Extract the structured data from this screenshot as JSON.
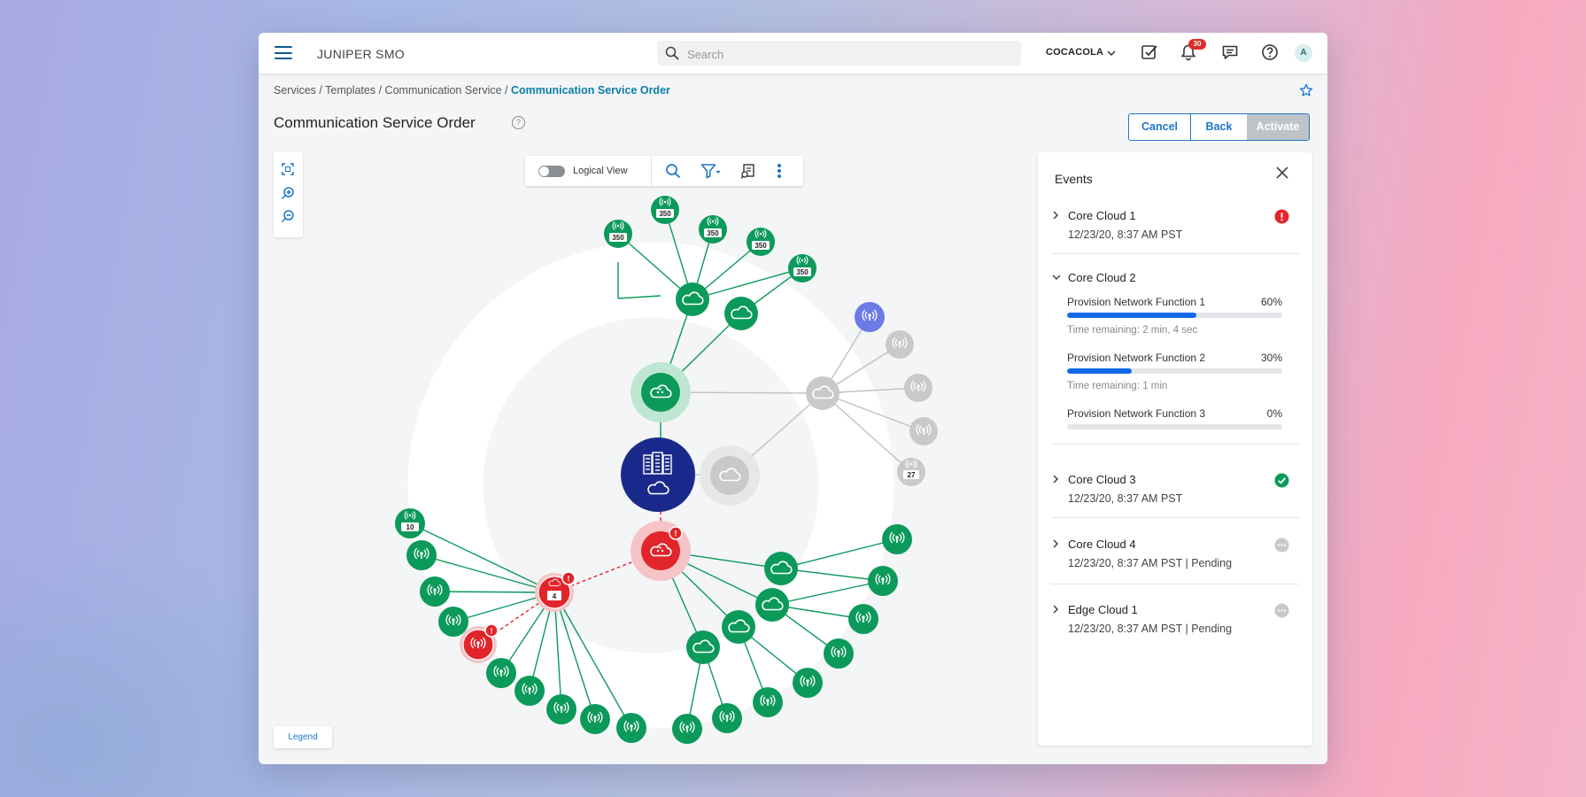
{
  "app": {
    "brand": "JUNIPER SMO"
  },
  "search": {
    "placeholder": "Search"
  },
  "org": {
    "name": "COCACOLA"
  },
  "notifications": {
    "count": "30"
  },
  "user": {
    "initial": "A"
  },
  "breadcrumb": {
    "items": [
      "Services",
      "Templates",
      "Communication Service"
    ],
    "current": "Communication Service Order",
    "separator": " / "
  },
  "page": {
    "title": "Communication Service Order"
  },
  "actions": {
    "cancel": "Cancel",
    "back": "Back",
    "activate": "Activate"
  },
  "canvas_toolbar": {
    "logical_view_label": "Logical View",
    "logical_view_on": false
  },
  "legend": {
    "label": "Legend"
  },
  "graph": {
    "colors": {
      "green": "#0c9a5a",
      "red": "#e1252b",
      "grey": "#c8c9cb",
      "navy": "#1a2a8c",
      "purple": "#6b7ce6"
    },
    "badges": {
      "cluster_top_a": "350",
      "cluster_top_b": "350",
      "cluster_top_c": "350",
      "cluster_top_d": "350",
      "cluster_top_e": "350",
      "grey_leaf": "27",
      "left_leaf": "10",
      "red_hub": "4"
    }
  },
  "events": {
    "title": "Events",
    "items": [
      {
        "name": "Core Cloud 1",
        "sub": "12/23/20, 8:37 AM PST",
        "status": "error",
        "expanded": false
      },
      {
        "name": "Core Cloud 2",
        "status": "progress",
        "expanded": true,
        "functions": [
          {
            "label": "Provision Network Function 1",
            "percent_label": "60%",
            "progress": 0.6,
            "remaining": "Time remaining: 2 min, 4 sec"
          },
          {
            "label": "Provision Network Function 2",
            "percent_label": "30%",
            "progress": 0.3,
            "remaining": "Time remaining: 1 min"
          },
          {
            "label": "Provision Network Function 3",
            "percent_label": "0%",
            "progress": 0,
            "remaining": ""
          }
        ]
      },
      {
        "name": "Core Cloud 3",
        "sub": "12/23/20, 8:37 AM PST",
        "status": "success",
        "expanded": false
      },
      {
        "name": "Core Cloud 4",
        "sub": "12/23/20, 8:37 AM PST | Pending",
        "status": "pending",
        "expanded": false
      },
      {
        "name": "Edge Cloud 1",
        "sub": "12/23/20, 8:37 AM PST | Pending",
        "status": "pending",
        "expanded": false
      }
    ]
  }
}
